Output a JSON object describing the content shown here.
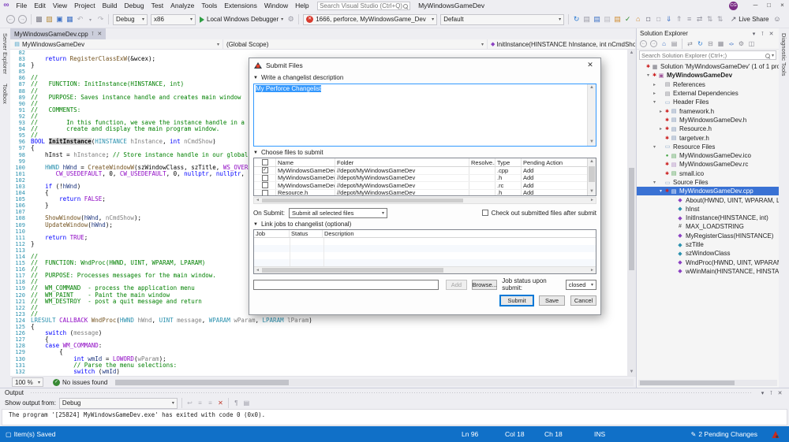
{
  "titlebar": {
    "menus": [
      "File",
      "Edit",
      "View",
      "Project",
      "Build",
      "Debug",
      "Test",
      "Analyze",
      "Tools",
      "Extensions",
      "Window",
      "Help"
    ],
    "search_placeholder": "Search Visual Studio (Ctrl+Q)",
    "window_title": "MyWindowsGameDev",
    "avatar_initials": "CG",
    "minimize": "─",
    "maximize": "□",
    "close": "×"
  },
  "toolbar": {
    "config_label": "Debug",
    "platform_label": "x86",
    "run_label": "Local Windows Debugger",
    "error_status_label": "1666, perforce, MyWindowsGame_Dev",
    "view_label": "Default",
    "live_share_label": "Live Share"
  },
  "side_tabs": {
    "left": [
      "Server Explorer",
      "Toolbox"
    ],
    "right": [
      "Diagnostic Tools"
    ]
  },
  "editor": {
    "tab_title": "MyWindowsGameDev.cpp",
    "breadcrumbs": [
      "MyWindowsGameDev",
      "(Global Scope)",
      "InitInstance(HINSTANCE hInstance, int nCmdShow)"
    ],
    "zoom_level": "100 %",
    "issues_label": "No issues found",
    "lines": [
      {
        "n": 82,
        "s": []
      },
      {
        "n": 83,
        "s": [
          {
            "c": "d",
            "t": "    "
          },
          {
            "c": "k",
            "t": "return"
          },
          {
            "c": "d",
            "t": " "
          },
          {
            "c": "f",
            "t": "RegisterClassExW"
          },
          {
            "c": "d",
            "t": "(&wcex);"
          }
        ]
      },
      {
        "n": 84,
        "s": [
          {
            "c": "d",
            "t": "}"
          }
        ]
      },
      {
        "n": 85,
        "s": []
      },
      {
        "n": 86,
        "s": [
          {
            "c": "c",
            "t": "//"
          }
        ]
      },
      {
        "n": 87,
        "s": [
          {
            "c": "c",
            "t": "//   FUNCTION: InitInstance(HINSTANCE, int)"
          }
        ]
      },
      {
        "n": 88,
        "s": [
          {
            "c": "c",
            "t": "//"
          }
        ]
      },
      {
        "n": 89,
        "s": [
          {
            "c": "c",
            "t": "//   PURPOSE: Saves instance handle and creates main window"
          }
        ]
      },
      {
        "n": 90,
        "s": [
          {
            "c": "c",
            "t": "//"
          }
        ]
      },
      {
        "n": 91,
        "s": [
          {
            "c": "c",
            "t": "//   COMMENTS:"
          }
        ]
      },
      {
        "n": 92,
        "s": [
          {
            "c": "c",
            "t": "//"
          }
        ]
      },
      {
        "n": 93,
        "s": [
          {
            "c": "c",
            "t": "//        In this function, we save the instance handle in a global variable and"
          }
        ]
      },
      {
        "n": 94,
        "s": [
          {
            "c": "c",
            "t": "//        create and display the main program window."
          }
        ]
      },
      {
        "n": 95,
        "s": [
          {
            "c": "c",
            "t": "//"
          }
        ]
      },
      {
        "n": 96,
        "s": [
          {
            "c": "k",
            "t": "BOOL"
          },
          {
            "c": "d",
            "t": " "
          },
          {
            "c": "hl",
            "t": "InitInstance"
          },
          {
            "c": "d",
            "t": "("
          },
          {
            "c": "t",
            "t": "HINSTANCE"
          },
          {
            "c": "p",
            "t": " hInstance"
          },
          {
            "c": "d",
            "t": ", "
          },
          {
            "c": "k",
            "t": "int"
          },
          {
            "c": "p",
            "t": " nCmdShow"
          },
          {
            "c": "d",
            "t": ")"
          }
        ]
      },
      {
        "n": 97,
        "s": [
          {
            "c": "d",
            "t": "{"
          }
        ]
      },
      {
        "n": 98,
        "s": [
          {
            "c": "d",
            "t": "    hInst = "
          },
          {
            "c": "p",
            "t": "hInstance"
          },
          {
            "c": "d",
            "t": "; "
          },
          {
            "c": "c",
            "t": "// Store instance handle in our global variable"
          }
        ]
      },
      {
        "n": 99,
        "s": []
      },
      {
        "n": 100,
        "s": [
          {
            "c": "d",
            "t": "    "
          },
          {
            "c": "t",
            "t": "HWND"
          },
          {
            "c": "d",
            "t": " "
          },
          {
            "c": "v",
            "t": "hWnd"
          },
          {
            "c": "d",
            "t": " = "
          },
          {
            "c": "f",
            "t": "CreateWindowW"
          },
          {
            "c": "d",
            "t": "(szWindowClass, szTitle, "
          },
          {
            "c": "m",
            "t": "WS_OVERLAPPEDWINDOW"
          },
          {
            "c": "d",
            "t": ","
          }
        ]
      },
      {
        "n": 101,
        "s": [
          {
            "c": "d",
            "t": "       "
          },
          {
            "c": "m",
            "t": "CW_USEDEFAULT"
          },
          {
            "c": "d",
            "t": ", 0, "
          },
          {
            "c": "m",
            "t": "CW_USEDEFAULT"
          },
          {
            "c": "d",
            "t": ", 0, "
          },
          {
            "c": "k",
            "t": "nullptr"
          },
          {
            "c": "d",
            "t": ", "
          },
          {
            "c": "k",
            "t": "nullptr"
          },
          {
            "c": "d",
            "t": ", "
          },
          {
            "c": "p",
            "t": "hInstance"
          },
          {
            "c": "d",
            "t": ", "
          },
          {
            "c": "k",
            "t": "nullptr"
          },
          {
            "c": "d",
            "t": ");"
          }
        ]
      },
      {
        "n": 102,
        "s": []
      },
      {
        "n": 103,
        "s": [
          {
            "c": "d",
            "t": "    "
          },
          {
            "c": "k",
            "t": "if"
          },
          {
            "c": "d",
            "t": " (!"
          },
          {
            "c": "v",
            "t": "hWnd"
          },
          {
            "c": "d",
            "t": ")"
          }
        ]
      },
      {
        "n": 104,
        "s": [
          {
            "c": "d",
            "t": "    {"
          }
        ]
      },
      {
        "n": 105,
        "s": [
          {
            "c": "d",
            "t": "        "
          },
          {
            "c": "k",
            "t": "return"
          },
          {
            "c": "d",
            "t": " "
          },
          {
            "c": "m",
            "t": "FALSE"
          },
          {
            "c": "d",
            "t": ";"
          }
        ]
      },
      {
        "n": 106,
        "s": [
          {
            "c": "d",
            "t": "    }"
          }
        ]
      },
      {
        "n": 107,
        "s": []
      },
      {
        "n": 108,
        "s": [
          {
            "c": "d",
            "t": "    "
          },
          {
            "c": "f",
            "t": "ShowWindow"
          },
          {
            "c": "d",
            "t": "("
          },
          {
            "c": "v",
            "t": "hWnd"
          },
          {
            "c": "d",
            "t": ", "
          },
          {
            "c": "p",
            "t": "nCmdShow"
          },
          {
            "c": "d",
            "t": ");"
          }
        ]
      },
      {
        "n": 109,
        "s": [
          {
            "c": "d",
            "t": "    "
          },
          {
            "c": "f",
            "t": "UpdateWindow"
          },
          {
            "c": "d",
            "t": "("
          },
          {
            "c": "v",
            "t": "hWnd"
          },
          {
            "c": "d",
            "t": ");"
          }
        ]
      },
      {
        "n": 110,
        "s": []
      },
      {
        "n": 111,
        "s": [
          {
            "c": "d",
            "t": "    "
          },
          {
            "c": "k",
            "t": "return"
          },
          {
            "c": "d",
            "t": " "
          },
          {
            "c": "m",
            "t": "TRUE"
          },
          {
            "c": "d",
            "t": ";"
          }
        ]
      },
      {
        "n": 112,
        "s": [
          {
            "c": "d",
            "t": "}"
          }
        ]
      },
      {
        "n": 113,
        "s": []
      },
      {
        "n": 114,
        "s": [
          {
            "c": "c",
            "t": "//"
          }
        ]
      },
      {
        "n": 115,
        "s": [
          {
            "c": "c",
            "t": "//  FUNCTION: WndProc(HWND, UINT, WPARAM, LPARAM)"
          }
        ]
      },
      {
        "n": 116,
        "s": [
          {
            "c": "c",
            "t": "//"
          }
        ]
      },
      {
        "n": 117,
        "s": [
          {
            "c": "c",
            "t": "//  PURPOSE: Processes messages for the main window."
          }
        ]
      },
      {
        "n": 118,
        "s": [
          {
            "c": "c",
            "t": "//"
          }
        ]
      },
      {
        "n": 119,
        "s": [
          {
            "c": "c",
            "t": "//  WM_COMMAND  - process the application menu"
          }
        ]
      },
      {
        "n": 120,
        "s": [
          {
            "c": "c",
            "t": "//  WM_PAINT    - Paint the main window"
          }
        ]
      },
      {
        "n": 121,
        "s": [
          {
            "c": "c",
            "t": "//  WM_DESTROY  - post a quit message and return"
          }
        ]
      },
      {
        "n": 122,
        "s": [
          {
            "c": "c",
            "t": "//"
          }
        ]
      },
      {
        "n": 123,
        "s": [
          {
            "c": "c",
            "t": "//"
          }
        ]
      },
      {
        "n": 124,
        "s": [
          {
            "c": "t",
            "t": "LRESULT"
          },
          {
            "c": "d",
            "t": " "
          },
          {
            "c": "m",
            "t": "CALLBACK"
          },
          {
            "c": "d",
            "t": " "
          },
          {
            "c": "f",
            "t": "WndProc"
          },
          {
            "c": "d",
            "t": "("
          },
          {
            "c": "t",
            "t": "HWND"
          },
          {
            "c": "p",
            "t": " hWnd"
          },
          {
            "c": "d",
            "t": ", "
          },
          {
            "c": "t",
            "t": "UINT"
          },
          {
            "c": "p",
            "t": " message"
          },
          {
            "c": "d",
            "t": ", "
          },
          {
            "c": "t",
            "t": "WPARAM"
          },
          {
            "c": "p",
            "t": " wParam"
          },
          {
            "c": "d",
            "t": ", "
          },
          {
            "c": "t",
            "t": "LPARAM"
          },
          {
            "c": "p",
            "t": " lParam"
          },
          {
            "c": "d",
            "t": ")"
          }
        ]
      },
      {
        "n": 125,
        "s": [
          {
            "c": "d",
            "t": "{"
          }
        ]
      },
      {
        "n": 126,
        "s": [
          {
            "c": "d",
            "t": "    "
          },
          {
            "c": "k",
            "t": "switch"
          },
          {
            "c": "d",
            "t": " ("
          },
          {
            "c": "p",
            "t": "message"
          },
          {
            "c": "d",
            "t": ")"
          }
        ]
      },
      {
        "n": 127,
        "s": [
          {
            "c": "d",
            "t": "    {"
          }
        ]
      },
      {
        "n": 128,
        "s": [
          {
            "c": "d",
            "t": "    "
          },
          {
            "c": "k",
            "t": "case"
          },
          {
            "c": "d",
            "t": " "
          },
          {
            "c": "m",
            "t": "WM_COMMAND"
          },
          {
            "c": "d",
            "t": ":"
          }
        ]
      },
      {
        "n": 129,
        "s": [
          {
            "c": "d",
            "t": "        {"
          }
        ]
      },
      {
        "n": 130,
        "s": [
          {
            "c": "d",
            "t": "            "
          },
          {
            "c": "k",
            "t": "int"
          },
          {
            "c": "d",
            "t": " "
          },
          {
            "c": "v",
            "t": "wmId"
          },
          {
            "c": "d",
            "t": " = "
          },
          {
            "c": "m",
            "t": "LOWORD"
          },
          {
            "c": "d",
            "t": "("
          },
          {
            "c": "p",
            "t": "wParam"
          },
          {
            "c": "d",
            "t": ");"
          }
        ]
      },
      {
        "n": 131,
        "s": [
          {
            "c": "c",
            "t": "            // Parse the menu selections:"
          }
        ]
      },
      {
        "n": 132,
        "s": [
          {
            "c": "d",
            "t": "            "
          },
          {
            "c": "k",
            "t": "switch"
          },
          {
            "c": "d",
            "t": " ("
          },
          {
            "c": "v",
            "t": "wmId"
          },
          {
            "c": "d",
            "t": ")"
          }
        ]
      }
    ]
  },
  "dialog": {
    "title": "Submit Files",
    "description_section": "Write a changelist description",
    "description_value": "My Perforce Changelist",
    "files_section": "Choose files to submit",
    "files": {
      "headers": [
        "Name",
        "Folder",
        "Resolve..",
        "Type",
        "Pending Action"
      ],
      "rows": [
        {
          "checked": true,
          "name": "MyWindowsGameDev.c...",
          "folder": "//depot/MyWindowsGameDev",
          "resolve": "",
          "type": ".cpp",
          "action": "Add"
        },
        {
          "checked": false,
          "name": "MyWindowsGameDev.h",
          "folder": "//depot/MyWindowsGameDev",
          "resolve": "",
          "type": ".h",
          "action": "Add"
        },
        {
          "checked": false,
          "name": "MyWindowsGameDev.rc",
          "folder": "//depot/MyWindowsGameDev",
          "resolve": "",
          "type": ".rc",
          "action": "Add"
        },
        {
          "checked": false,
          "name": "Resource.h",
          "folder": "//depot/MyWindowsGameDev",
          "resolve": "",
          "type": ".h",
          "action": "Add"
        }
      ]
    },
    "on_submit_label": "On Submit:",
    "on_submit_value": "Submit all selected files",
    "checkout_label": "Check out submitted files after submit",
    "jobs_section": "Link jobs to changelist (optional)",
    "jobs_headers": [
      "Job",
      "Status",
      "Description"
    ],
    "add_label": "Add",
    "browse_label": "Browse...",
    "job_status_label": "Job status upon submit:",
    "job_status_value": "closed",
    "buttons": {
      "submit": "Submit",
      "save": "Save",
      "cancel": "Cancel"
    }
  },
  "solution_explorer": {
    "title": "Solution Explorer",
    "search_placeholder": "Search Solution Explorer (Ctrl+;)",
    "tree": [
      {
        "label": "Solution 'MyWindowsGameDev' (1 of 1 project)",
        "depth": 0,
        "icon": "solution-icon",
        "marker": "red"
      },
      {
        "label": "MyWindowsGameDev",
        "depth": 1,
        "icon": "cpp-project-icon",
        "exp": "expanded",
        "marker": "red",
        "bold": true
      },
      {
        "label": "References",
        "depth": 2,
        "icon": "references-icon",
        "exp": "collapsed"
      },
      {
        "label": "External Dependencies",
        "depth": 2,
        "icon": "external-dependencies-icon",
        "exp": "collapsed"
      },
      {
        "label": "Header Files",
        "depth": 2,
        "icon": "folder-icon",
        "exp": "expanded"
      },
      {
        "label": "framework.h",
        "depth": 3,
        "icon": "header-file-icon",
        "exp": "collapsed",
        "marker": "red"
      },
      {
        "label": "MyWindowsGameDev.h",
        "depth": 3,
        "icon": "header-file-icon",
        "marker": "red"
      },
      {
        "label": "Resource.h",
        "depth": 3,
        "icon": "header-file-icon",
        "exp": "collapsed",
        "marker": "red"
      },
      {
        "label": "targetver.h",
        "depth": 3,
        "icon": "header-file-icon",
        "marker": "red"
      },
      {
        "label": "Resource Files",
        "depth": 2,
        "icon": "folder-icon",
        "exp": "expanded"
      },
      {
        "label": "MyWindowsGameDev.ico",
        "depth": 3,
        "icon": "ico-file-icon",
        "marker": "green"
      },
      {
        "label": "MyWindowsGameDev.rc",
        "depth": 3,
        "icon": "rc-file-icon",
        "marker": "red"
      },
      {
        "label": "small.ico",
        "depth": 3,
        "icon": "ico-file-icon",
        "marker": "red"
      },
      {
        "label": "Source Files",
        "depth": 2,
        "icon": "folder-icon",
        "exp": "expanded"
      },
      {
        "label": "MyWindowsGameDev.cpp",
        "depth": 3,
        "icon": "cpp-file-icon",
        "exp": "expanded",
        "marker": "red",
        "selected": true
      },
      {
        "label": "About(HWND, UINT, WPARAM, LPARAM)",
        "depth": 4,
        "icon": "method-icon"
      },
      {
        "label": "hInst",
        "depth": 4,
        "icon": "field-icon"
      },
      {
        "label": "InitInstance(HINSTANCE, int)",
        "depth": 4,
        "icon": "method-icon"
      },
      {
        "label": "MAX_LOADSTRING",
        "depth": 4,
        "icon": "macro-icon"
      },
      {
        "label": "MyRegisterClass(HINSTANCE)",
        "depth": 4,
        "icon": "method-icon"
      },
      {
        "label": "szTitle",
        "depth": 4,
        "icon": "field-icon"
      },
      {
        "label": "szWindowClass",
        "depth": 4,
        "icon": "field-icon"
      },
      {
        "label": "WndProc(HWND, UINT, WPARAM, LPARAM)",
        "depth": 4,
        "icon": "method-icon"
      },
      {
        "label": "wWinMain(HINSTANCE, HINSTANCE, LPWSTR",
        "depth": 4,
        "icon": "method-icon"
      }
    ]
  },
  "output": {
    "title": "Output",
    "source_label": "Show output from:",
    "source_value": "Debug",
    "log_line": "The program '[25824] MyWindowsGameDev.exe' has exited with code 0 (0x0)."
  },
  "statusbar": {
    "message": "Item(s) Saved",
    "line": "Ln 96",
    "column": "Col 18",
    "character": "Ch 18",
    "mode": "INS",
    "pending_changes": "2 Pending Changes"
  }
}
